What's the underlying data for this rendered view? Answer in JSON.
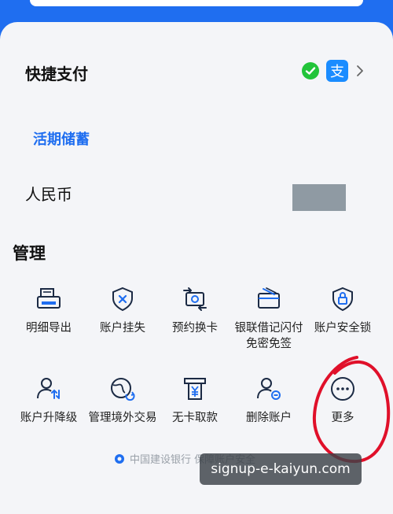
{
  "quick_pay": {
    "title": "快捷支付"
  },
  "account": {
    "type": "活期储蓄",
    "currency": "人民币"
  },
  "manage": {
    "title": "管理",
    "items": [
      {
        "id": "detail-export",
        "label": "明细导出",
        "icon": "printer-icon"
      },
      {
        "id": "report-loss",
        "label": "账户挂失",
        "icon": "shield-x-icon"
      },
      {
        "id": "card-replace",
        "label": "预约换卡",
        "icon": "card-swap-icon"
      },
      {
        "id": "unionpay-quickpay",
        "label": "银联借记闪付免密免签",
        "label_line1": "银联借记闪付",
        "label_line2": "免密免签",
        "icon": "card-tap-icon"
      },
      {
        "id": "security-lock",
        "label": "账户安全锁",
        "icon": "shield-lock-icon"
      },
      {
        "id": "upgrade-downgrade",
        "label": "账户升降级",
        "icon": "user-arrows-icon"
      },
      {
        "id": "overseas-tx",
        "label": "管理境外交易",
        "icon": "globe-refresh-icon"
      },
      {
        "id": "cardless-withdraw",
        "label": "无卡取款",
        "icon": "atm-yuan-icon"
      },
      {
        "id": "delete-account",
        "label": "删除账户",
        "icon": "user-minus-icon"
      },
      {
        "id": "more",
        "label": "更多",
        "icon": "more-dots-icon"
      }
    ]
  },
  "footer": {
    "text": "中国建设银行 保障账户安全"
  },
  "watermark": {
    "text": "signup-e-kaiyun.com"
  },
  "colors": {
    "brand": "#1f6ef0",
    "annotation": "#e0102a",
    "icon_dark": "#1b2a44"
  }
}
